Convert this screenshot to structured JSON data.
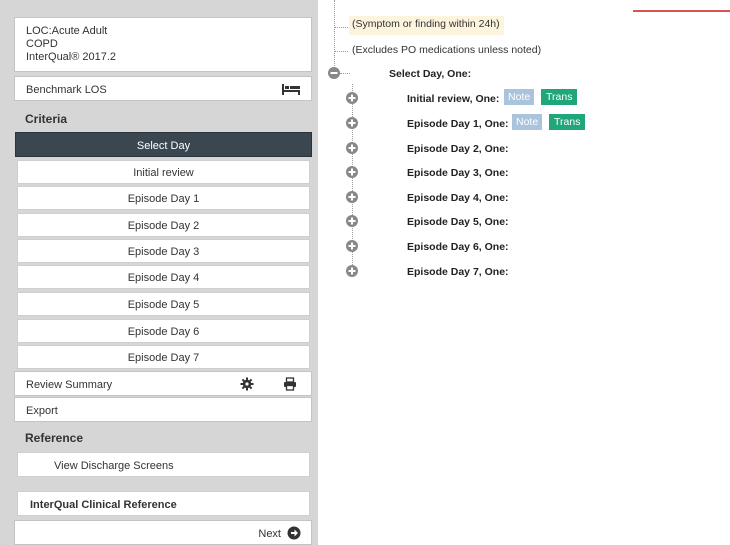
{
  "left_panel": {
    "context": {
      "line1": "LOC:Acute Adult",
      "line2": "COPD",
      "line3": "InterQual® 2017.2"
    },
    "benchmark_los": "Benchmark LOS",
    "criteria_header": "Criteria",
    "select_day": "Select Day",
    "episodes": [
      "Initial review",
      "Episode Day 1",
      "Episode Day 2",
      "Episode Day 3",
      "Episode Day 4",
      "Episode Day 5",
      "Episode Day 6",
      "Episode Day 7"
    ],
    "review_summary": "Review Summary",
    "export": "Export",
    "reference_header": "Reference",
    "view_discharge": "View Discharge Screens",
    "interqual_ref": "InterQual Clinical Reference",
    "next": "Next"
  },
  "tree": {
    "note_symptom": "(Symptom or finding within 24h)",
    "note_excludes": "(Excludes PO medications unless noted)",
    "select_day_label": "Select Day, One:",
    "items": [
      {
        "label": "Initial review, One:",
        "note": "Note",
        "trans": "Trans"
      },
      {
        "label": "Episode Day 1, One:",
        "note": "Note",
        "trans": "Trans"
      },
      {
        "label": "Episode Day 2, One:"
      },
      {
        "label": "Episode Day 3, One:"
      },
      {
        "label": "Episode Day 4, One:"
      },
      {
        "label": "Episode Day 5, One:"
      },
      {
        "label": "Episode Day 6, One:"
      },
      {
        "label": "Episode Day 7, One:"
      }
    ]
  },
  "colors": {
    "selected_bg": "#3b4750",
    "note_bg": "#a9c4dc",
    "trans_bg": "#1fa67a",
    "accent_red": "#d9534f",
    "highlight_bg": "#fdf4dd"
  }
}
